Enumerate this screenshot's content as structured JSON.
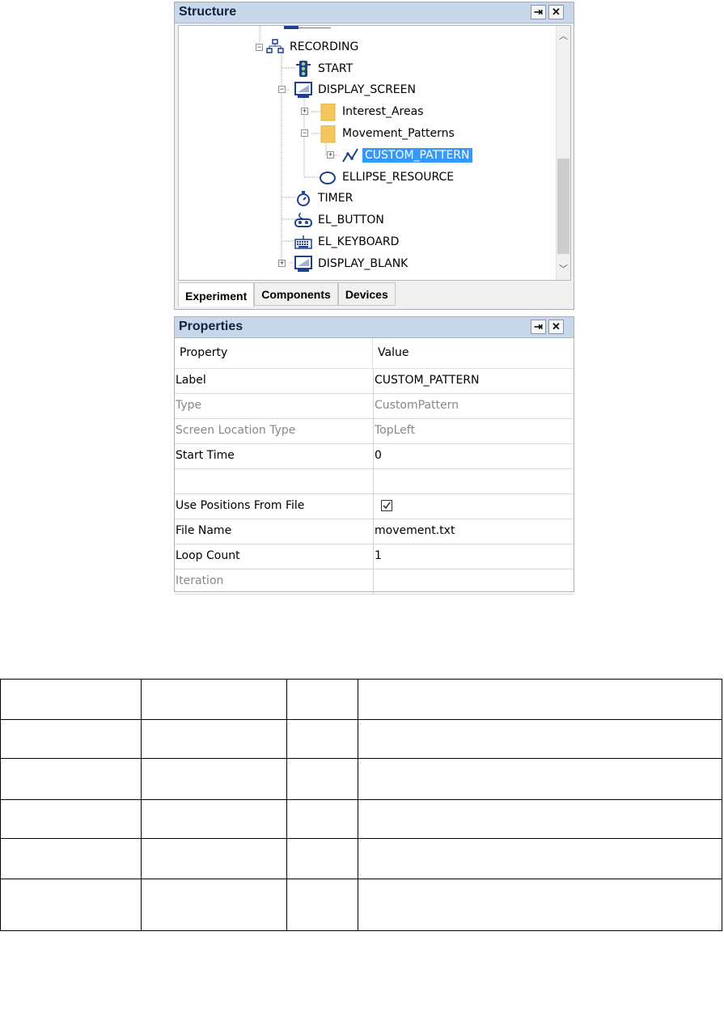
{
  "structure": {
    "title": "Structure",
    "tree": [
      {
        "label": "RECORDING",
        "icon": "sequence-icon",
        "expander": "−"
      },
      {
        "label": "START",
        "icon": "traffic-light-icon"
      },
      {
        "label": "DISPLAY_SCREEN",
        "icon": "monitor-icon",
        "expander": "−"
      },
      {
        "label": "Interest_Areas",
        "icon": "folder-icon",
        "expander": "+"
      },
      {
        "label": "Movement_Patterns",
        "icon": "folder-icon",
        "expander": "−"
      },
      {
        "label": "CUSTOM_PATTERN",
        "icon": "custom-pattern-icon",
        "expander": "+",
        "selected": true
      },
      {
        "label": "ELLIPSE_RESOURCE",
        "icon": "ellipse-icon"
      },
      {
        "label": "TIMER",
        "icon": "stopwatch-icon"
      },
      {
        "label": "EL_BUTTON",
        "icon": "gamepad-icon"
      },
      {
        "label": "EL_KEYBOARD",
        "icon": "keyboard-icon"
      },
      {
        "label": "DISPLAY_BLANK",
        "icon": "monitor-icon",
        "expander": "+"
      }
    ],
    "tabs": [
      "Experiment",
      "Components",
      "Devices"
    ],
    "active_tab": "Experiment"
  },
  "properties": {
    "title": "Properties",
    "header": {
      "property": "Property",
      "value": "Value"
    },
    "rows": [
      {
        "property": "Label",
        "value": "CUSTOM_PATTERN",
        "readonly": false
      },
      {
        "property": "Type",
        "value": "CustomPattern",
        "readonly": true
      },
      {
        "property": "Screen Location Type",
        "value": "TopLeft",
        "readonly": true
      },
      {
        "property": "Start Time",
        "value": "0",
        "readonly": false
      },
      {
        "property": "",
        "value": "",
        "readonly": false
      },
      {
        "property": "Use Positions From File",
        "value": "",
        "checkbox": true,
        "checked": true,
        "readonly": false
      },
      {
        "property": "File Name",
        "value": "movement.txt",
        "readonly": false
      },
      {
        "property": "Loop Count",
        "value": "1",
        "readonly": false
      },
      {
        "property": "Iteration",
        "value": "",
        "readonly": true
      }
    ]
  },
  "icons": {
    "pin": "pin-icon",
    "close": "close-icon"
  },
  "colors": {
    "titlebar": "#c9d7ea",
    "selection": "#3399ff",
    "icon_blue": "#1f3f8f",
    "folder": "#f5c75a"
  }
}
